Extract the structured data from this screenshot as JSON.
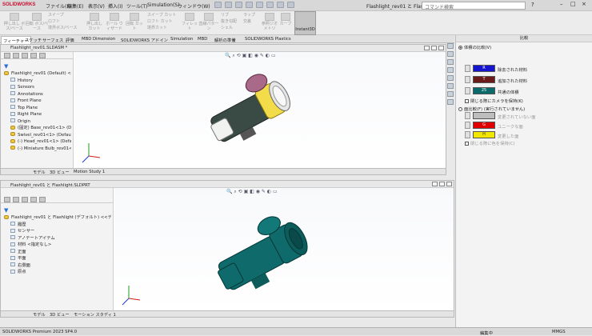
{
  "app": {
    "logo": "SOLIDWORKS"
  },
  "menu": [
    "ファイル(F)",
    "編集(E)",
    "表示(V)",
    "挿入(I)",
    "ツール(T)",
    "Simulation(S)",
    "ウィンドウ(W)"
  ],
  "document_title": "Flashlight_rev01 と Flashlight.SLD...",
  "search": {
    "placeholder": "コマンド検索"
  },
  "toolbar": {
    "items": [
      "押し出し ボス/ベース",
      "回転 ボス/ベース",
      "スイープ",
      "ロフト",
      "境界ボス/ベース",
      "押し出し カット",
      "ホール ウィザード",
      "回転 カット",
      "スイープ カット",
      "ロフト カット",
      "境界カット",
      "フィレット",
      "直線パターン",
      "リブ",
      "抜き勾配",
      "シェル",
      "ラップ",
      "交差",
      "参照ジオメトリ",
      "カーブ"
    ],
    "instant3d": "Instant3D"
  },
  "tabs": [
    "フィーチャー",
    "スケッチ",
    "サーフェス",
    "評価",
    "MBD Dimension",
    "SOLIDWORKS アドイン",
    "Simulation",
    "MBD",
    "解析の準備",
    "SOLIDWORKS Plastics"
  ],
  "window_top": {
    "title": "Flashlight_rev01.SLDASM *",
    "tree": [
      {
        "label": "Flashlight_rev01 (Default) <Displa",
        "indent": 0,
        "icon": "assembly-icon"
      },
      {
        "label": "History",
        "indent": 1,
        "icon": "history-icon"
      },
      {
        "label": "Sensors",
        "indent": 1,
        "icon": "sensor-icon"
      },
      {
        "label": "Annotations",
        "indent": 1,
        "icon": "annotation-icon"
      },
      {
        "label": "Front Plane",
        "indent": 1,
        "icon": "plane-icon"
      },
      {
        "label": "Top Plane",
        "indent": 1,
        "icon": "plane-icon"
      },
      {
        "label": "Right Plane",
        "indent": 1,
        "icon": "plane-icon"
      },
      {
        "label": "Origin",
        "indent": 1,
        "icon": "origin-icon"
      },
      {
        "label": "(固定) Base_rev01<1> (Defa",
        "indent": 1,
        "icon": "part-icon"
      },
      {
        "label": "Swivel_rev01<1> (Default<",
        "indent": 1,
        "icon": "part-icon"
      },
      {
        "label": "(-) Head_rev01<1> (Defau",
        "indent": 1,
        "icon": "part-icon"
      },
      {
        "label": "(-) Miniature Bulb_rev01<",
        "indent": 1,
        "icon": "part-icon"
      }
    ],
    "bottom_tabs": [
      "モデル",
      "3D ビュー",
      "Motion Study 1"
    ]
  },
  "window_bottom": {
    "title": "Flashlight_rev01 と Flashlight.SLDPRT",
    "tree": [
      {
        "label": "Flashlight_rev01 と Flashlight (デフォルト) <<デフォルト>",
        "indent": 0,
        "icon": "assembly-icon"
      },
      {
        "label": "履歴",
        "indent": 1,
        "icon": "history-icon"
      },
      {
        "label": "センサー",
        "indent": 1,
        "icon": "sensor-icon"
      },
      {
        "label": "アノテートアイテム",
        "indent": 1,
        "icon": "annotation-icon"
      },
      {
        "label": "材料 <指定なし>",
        "indent": 1,
        "icon": "material-icon"
      },
      {
        "label": "正面",
        "indent": 1,
        "icon": "plane-icon"
      },
      {
        "label": "平面",
        "indent": 1,
        "icon": "plane-icon"
      },
      {
        "label": "右側面",
        "indent": 1,
        "icon": "plane-icon"
      },
      {
        "label": "原点",
        "indent": 1,
        "icon": "origin-icon"
      }
    ],
    "bottom_tabs": [
      "モデル",
      "3D ビュー",
      "モーション スタディ 1"
    ]
  },
  "taskpane": {
    "title": "比較",
    "volume_compare": "体積の比較(V)",
    "removed": "除去された材料",
    "added": "追加された材料",
    "common": "共通の体積",
    "keep_camera": "閉じる際にカメラを保持(K)",
    "face_compare": "面比較(F) (実行されていません)",
    "unchanged_face": "変更されていない面",
    "unique_face": "ユニークな面",
    "changed_face": "変更した面",
    "keep_color": "閉じる際に色を保持(C)",
    "swatch_labels": {
      "removed": "R",
      "added": "T",
      "common": "25",
      "unique": "G",
      "changed": "H"
    },
    "colors": {
      "removed": "#1515d0",
      "added": "#6b1a1a",
      "common": "#0b6a6a",
      "unchanged": "#bdbdbd",
      "unique": "#e00000",
      "changed": "#f2e600"
    }
  },
  "status": {
    "left": "SOLIDWORKS Premium 2023 SP4.0",
    "edit": "編集中",
    "mmgs": "MMGS"
  }
}
